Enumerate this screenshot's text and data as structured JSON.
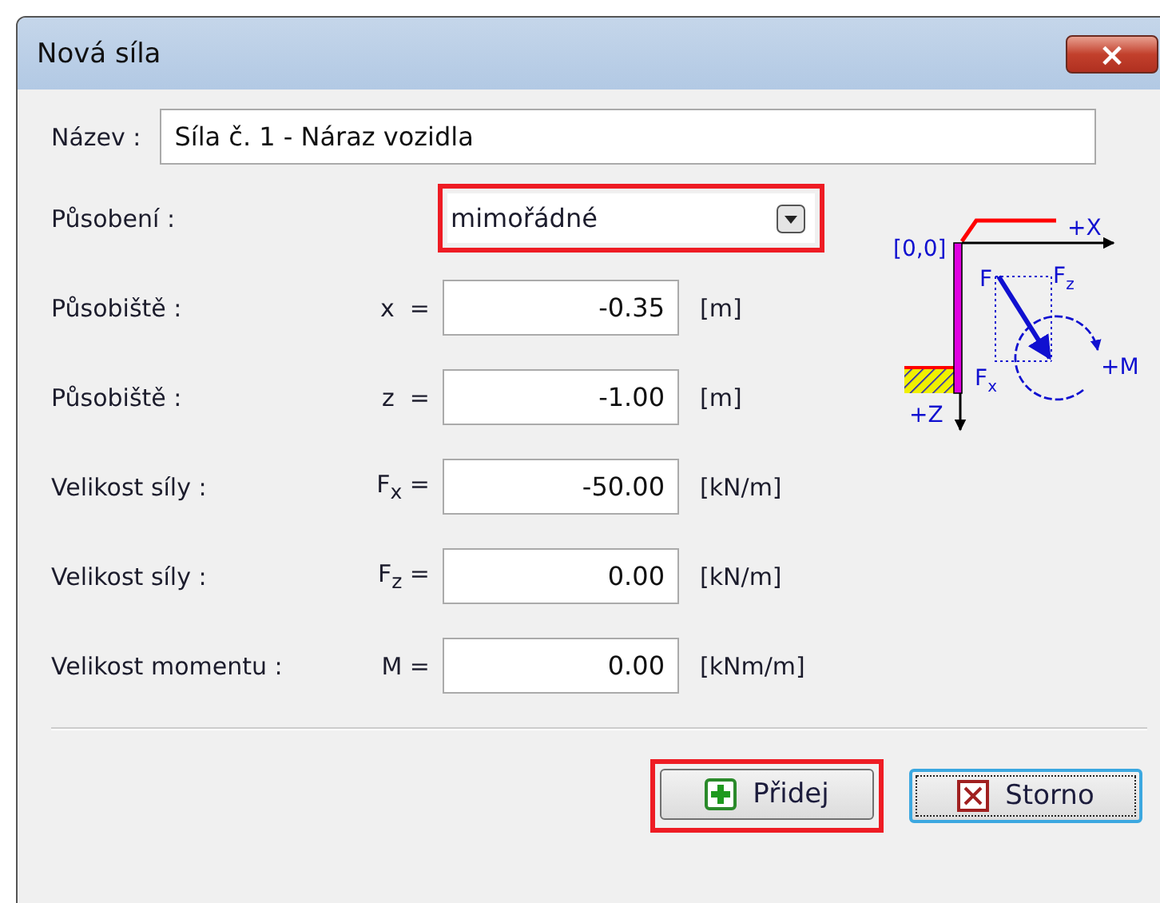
{
  "window": {
    "title": "Nová síla",
    "close": "×"
  },
  "name": {
    "label": "Název :",
    "value": "Síla č. 1 - Náraz vozidla"
  },
  "action": {
    "label": "Působení :",
    "value": "mimořádné",
    "highlighted": true
  },
  "diagram": {
    "origin": "[0,0]",
    "x_axis": "+X",
    "z_axis": "+Z",
    "force": "F",
    "force_x": {
      "symbol": "F",
      "index": "x"
    },
    "force_z": {
      "symbol": "F",
      "index": "z"
    },
    "moment": "+M"
  },
  "fields": [
    {
      "label": "Působiště :",
      "symbol": "x  =",
      "value": "-0.35",
      "unit": "[m]"
    },
    {
      "label": "Působiště :",
      "symbol": "z  =",
      "value": "-1.00",
      "unit": "[m]"
    },
    {
      "label": "Velikost síly :",
      "symbol": "F$_{x}$ =",
      "value": "-50.00",
      "unit": "[kN/m]"
    },
    {
      "label": "Velikost síly :",
      "symbol": "F$_{z}$ =",
      "value": "0.00",
      "unit": "[kN/m]"
    },
    {
      "label": "Velikost momentu :",
      "symbol": "M =",
      "value": "0.00",
      "unit": "[kNm/m]"
    }
  ],
  "buttons": [
    {
      "kind": "add",
      "label": "Přidej",
      "highlighted": true,
      "focused": false
    },
    {
      "kind": "cancel",
      "label": "Storno",
      "highlighted": false,
      "focused": true
    }
  ]
}
